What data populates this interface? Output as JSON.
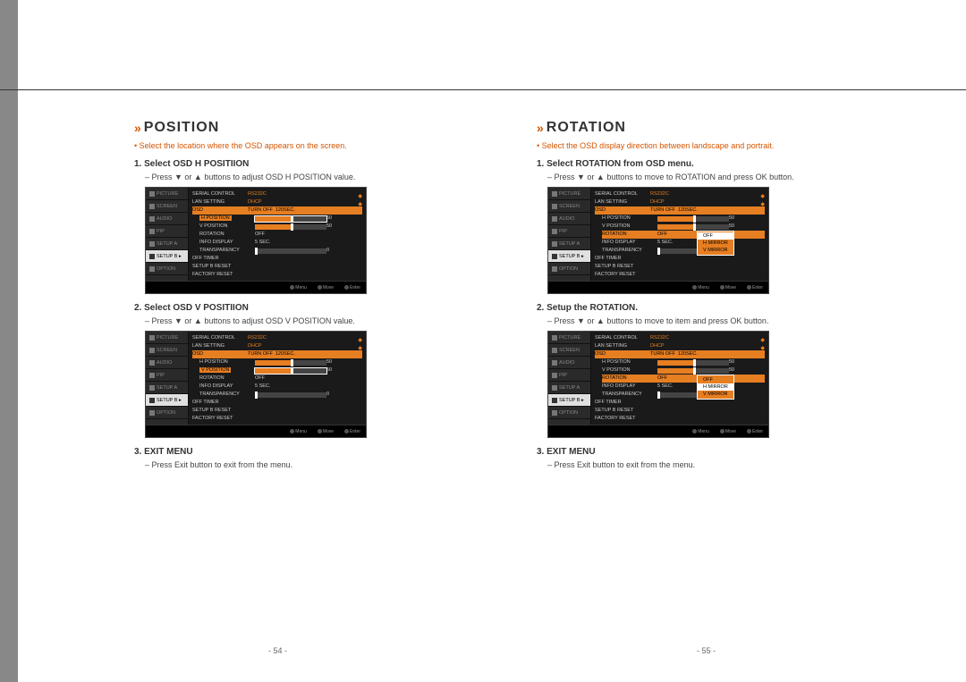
{
  "left": {
    "title": "POSITION",
    "subtitle": "Select the location where the OSD appears on the screen.",
    "steps": [
      {
        "num": "1.",
        "head": "Select OSD H POSITIION",
        "desc": "Press ▼ or ▲ buttons to adjust OSD H POSITION value."
      },
      {
        "num": "2.",
        "head": "Select OSD V POSITIION",
        "desc": "Press ▼ or ▲ buttons to adjust OSD V POSITION value."
      },
      {
        "num": "3.",
        "head": "EXIT MENU",
        "desc": "Press Exit button to exit from the menu."
      }
    ],
    "page": "- 54 -"
  },
  "right": {
    "title": "ROTATION",
    "subtitle": "Select the OSD display direction between landscape and portrait.",
    "steps": [
      {
        "num": "1.",
        "head": "Select ROTATION from OSD menu.",
        "desc": "Press ▼ or ▲ buttons to move to ROTATION and press OK button."
      },
      {
        "num": "2.",
        "head": "Setup the ROTATION.",
        "desc": "Press ▼ or ▲ buttons to move to item and press OK button."
      },
      {
        "num": "3.",
        "head": "EXIT MENU",
        "desc": "Press Exit button to exit from the menu."
      }
    ],
    "page": "- 55 -"
  },
  "osd": {
    "leftItems": [
      "PICTURE",
      "SCREEN",
      "AUDIO",
      "PIP",
      "SETUP A",
      "SETUP B ▸",
      "OPTION"
    ],
    "top": [
      {
        "label": "SERIAL CONTROL",
        "val": "RS232C",
        "orange": true
      },
      {
        "label": "LAN SETTING",
        "val": "DHCP",
        "orange": true
      }
    ],
    "osdGroup": {
      "header": "OSD",
      "rows": [
        {
          "label": "TURN OFF",
          "val": "120SEC."
        },
        {
          "label": "H POSITION",
          "slider": 50,
          "sval": "50"
        },
        {
          "label": "V POSITION",
          "slider": 50,
          "sval": "50"
        },
        {
          "label": "ROTATION",
          "val": "OFF"
        },
        {
          "label": "INFO DISPLAY",
          "val": "5 SEC."
        },
        {
          "label": "TRANSPARENCY",
          "slider": 0,
          "sval": "0"
        }
      ]
    },
    "bottom": [
      {
        "label": "OFF TIMER"
      },
      {
        "label": "SETUP B RESET"
      },
      {
        "label": "FACTORY RESET"
      }
    ],
    "rotationDropdown": [
      "OFF",
      "H MIRROR",
      "V MIRROR"
    ],
    "footer": [
      "Menu",
      "Move",
      "Enter"
    ]
  }
}
